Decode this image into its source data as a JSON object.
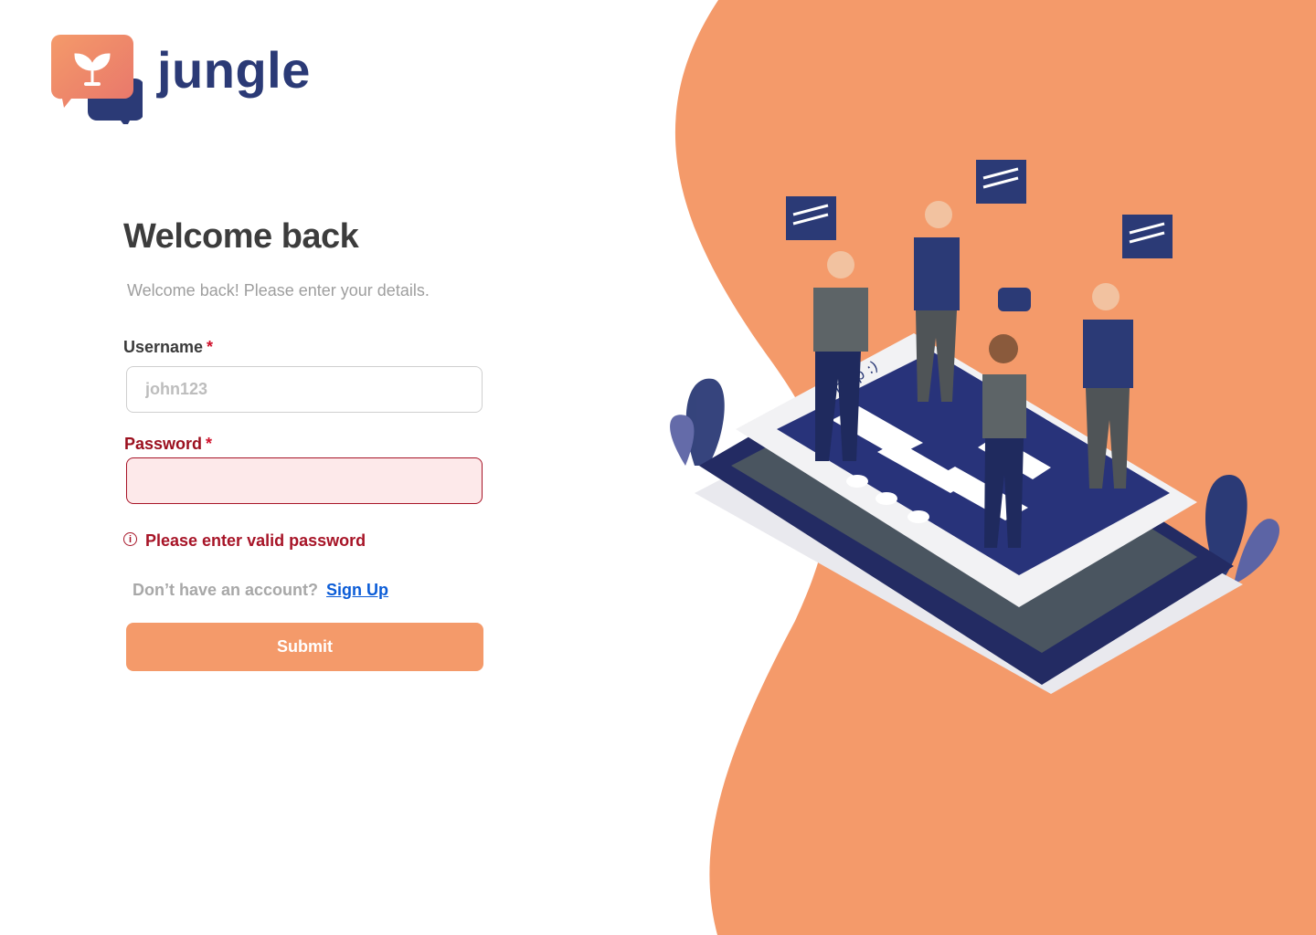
{
  "brand": {
    "name": "jungle",
    "logo_icon": "sprout-chat-bubble-icon"
  },
  "login": {
    "title": "Welcome back",
    "subtitle": "Welcome back! Please enter your details.",
    "username_label": "Username",
    "username_required_marker": "*",
    "username_placeholder": "john123",
    "password_label": "Password",
    "password_required_marker": "*",
    "password_value": "",
    "error_icon": "info-circle-icon",
    "error_message": "Please enter valid password",
    "signup_prompt": "Don’t have an account?",
    "signup_link": "Sign Up",
    "submit_label": "Submit"
  },
  "illustration": {
    "subject": "people-chatting-on-phone",
    "phone_screen_text": "(Group :)"
  },
  "colors": {
    "accent": "#f49a6a",
    "brand_navy": "#2b3a76",
    "error": "#a71427",
    "error_bg": "#fde9ea",
    "link": "#0b5cd7"
  }
}
